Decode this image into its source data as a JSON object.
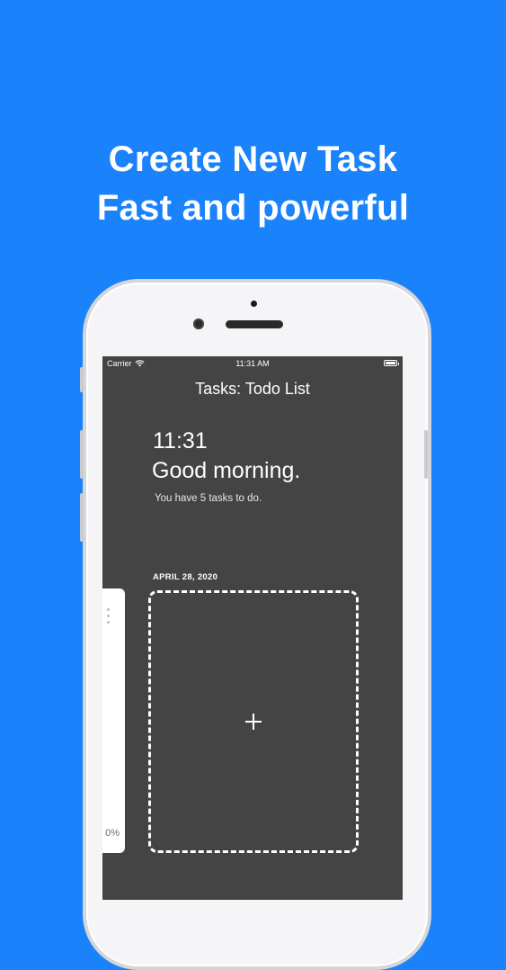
{
  "headline": {
    "line1": "Create New Task",
    "line2": "Fast and powerful"
  },
  "status_bar": {
    "carrier": "Carrier",
    "time": "11:31 AM"
  },
  "app": {
    "nav_title": "Tasks: Todo List",
    "time_large": "11:31",
    "greeting": "Good morning.",
    "tasks_summary": "You have 5 tasks to do.",
    "date_label": "APRIL 28, 2020",
    "previous_card_percent": "0%"
  },
  "colors": {
    "background": "#1a82fb",
    "screen": "#444444",
    "text": "#ffffff"
  },
  "icons": {
    "wifi": "wifi-icon",
    "battery": "battery-icon",
    "add": "plus-icon",
    "more": "more-vertical-icon"
  }
}
